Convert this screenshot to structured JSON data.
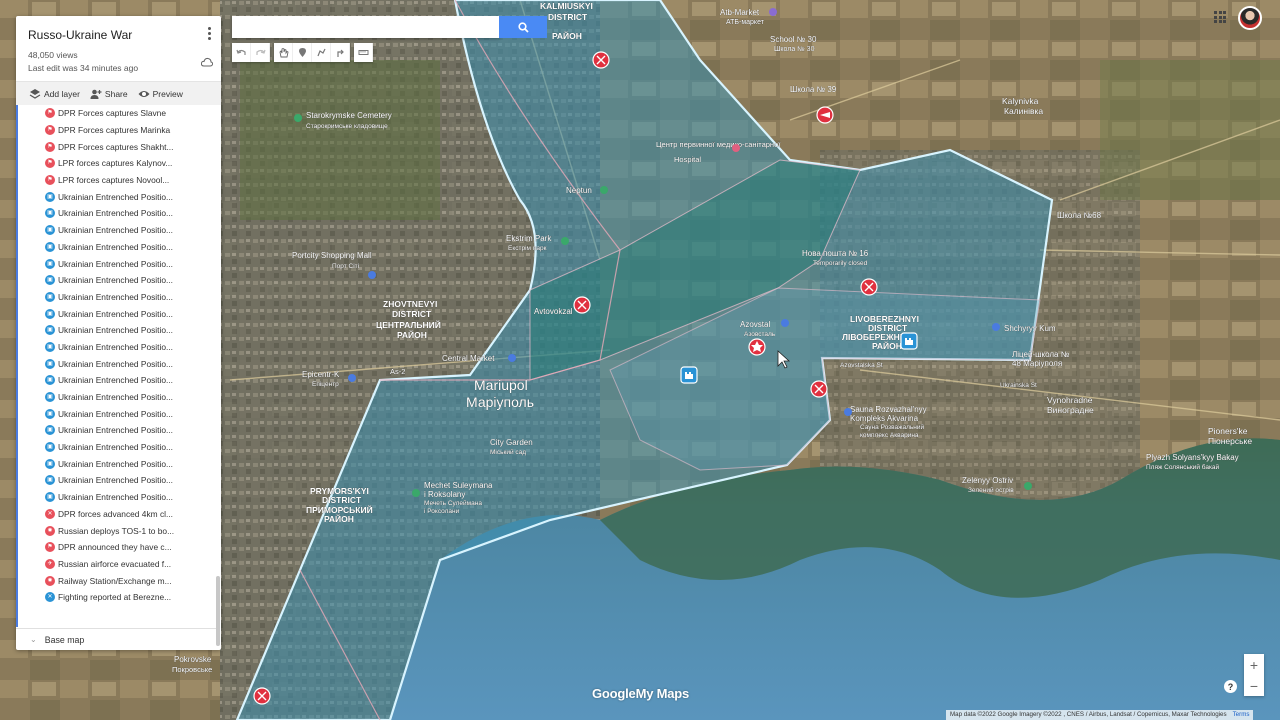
{
  "panel": {
    "title": "Russo-Ukraine War",
    "views": "48,050 views",
    "last_edit": "Last edit was 34 minutes ago",
    "actions": {
      "add_layer": "Add layer",
      "share": "Share",
      "preview": "Preview"
    },
    "base_map": "Base map",
    "items": [
      {
        "label": "DPR Forces captures Slavne",
        "icon": "flag-icon",
        "color": "#e8505b"
      },
      {
        "label": "DPR Forces captures Marinka",
        "icon": "flag-icon",
        "color": "#e8505b"
      },
      {
        "label": "DPR Forces captures Shakht...",
        "icon": "flag-icon",
        "color": "#e8505b"
      },
      {
        "label": "LPR forces captures Kalynov...",
        "icon": "flag-icon",
        "color": "#e8505b"
      },
      {
        "label": "LPR forces captures Novool...",
        "icon": "flag-icon",
        "color": "#e8505b"
      },
      {
        "label": "Ukrainian Entrenched Positio...",
        "icon": "fort-icon",
        "color": "#2a93d5"
      },
      {
        "label": "Ukrainian Entrenched Positio...",
        "icon": "fort-icon",
        "color": "#2a93d5"
      },
      {
        "label": "Ukrainian Entrenched Positio...",
        "icon": "fort-icon",
        "color": "#2a93d5"
      },
      {
        "label": "Ukrainian Entrenched Positio...",
        "icon": "fort-icon",
        "color": "#2a93d5"
      },
      {
        "label": "Ukrainian Entrenched Positio...",
        "icon": "fort-icon",
        "color": "#2a93d5"
      },
      {
        "label": "Ukrainian Entrenched Positio...",
        "icon": "fort-icon",
        "color": "#2a93d5"
      },
      {
        "label": "Ukrainian Entrenched Positio...",
        "icon": "fort-icon",
        "color": "#2a93d5"
      },
      {
        "label": "Ukrainian Entrenched Positio...",
        "icon": "fort-icon",
        "color": "#2a93d5"
      },
      {
        "label": "Ukrainian Entrenched Positio...",
        "icon": "fort-icon",
        "color": "#2a93d5"
      },
      {
        "label": "Ukrainian Entrenched Positio...",
        "icon": "fort-icon",
        "color": "#2a93d5"
      },
      {
        "label": "Ukrainian Entrenched Positio...",
        "icon": "fort-icon",
        "color": "#2a93d5"
      },
      {
        "label": "Ukrainian Entrenched Positio...",
        "icon": "fort-icon",
        "color": "#2a93d5"
      },
      {
        "label": "Ukrainian Entrenched Positio...",
        "icon": "fort-icon",
        "color": "#2a93d5"
      },
      {
        "label": "Ukrainian Entrenched Positio...",
        "icon": "fort-icon",
        "color": "#2a93d5"
      },
      {
        "label": "Ukrainian Entrenched Positio...",
        "icon": "fort-icon",
        "color": "#2a93d5"
      },
      {
        "label": "Ukrainian Entrenched Positio...",
        "icon": "fort-icon",
        "color": "#2a93d5"
      },
      {
        "label": "Ukrainian Entrenched Positio...",
        "icon": "fort-icon",
        "color": "#2a93d5"
      },
      {
        "label": "Ukrainian Entrenched Positio...",
        "icon": "fort-icon",
        "color": "#2a93d5"
      },
      {
        "label": "Ukrainian Entrenched Positio...",
        "icon": "fort-icon",
        "color": "#2a93d5"
      },
      {
        "label": "DPR forces advanced 4km cl...",
        "icon": "crossed-swords-icon",
        "color": "#e8505b"
      },
      {
        "label": "Russian deploys TOS-1 to bo...",
        "icon": "explosion-icon",
        "color": "#e8505b"
      },
      {
        "label": "DPR announced they have c...",
        "icon": "flag-icon",
        "color": "#e8505b"
      },
      {
        "label": "Russian airforce evacuated f...",
        "icon": "plane-icon",
        "color": "#e8505b"
      },
      {
        "label": "Railway Station/Exchange m...",
        "icon": "explosion-icon",
        "color": "#e8505b"
      },
      {
        "label": "Fighting reported at Berezne...",
        "icon": "crossed-swords-icon",
        "color": "#2a93d5"
      }
    ]
  },
  "search": {
    "placeholder": ""
  },
  "map": {
    "labels": {
      "kalmiuskyi_en": "KALMIUSKYI",
      "kalmiuskyi_district": "DISTRICT",
      "kalmiuskyi_ua": "РАЙОН",
      "atb": "Atb-Market",
      "atb_ua": "АТБ-маркет",
      "school30": "School № 30",
      "school30_ua": "Школа № 30",
      "school39": "Школа № 39",
      "kalynivka": "Kalynivka",
      "kalynivka_ua": "Калинівка",
      "starokrymske": "Starokrymske Cemetery",
      "starokrymske_ua": "Старокримське кладовище",
      "hospital": "Центр первинної медико-санітарної",
      "hospital_en": "Hospital",
      "neptun": "Neptun",
      "ekstrim": "Ekstrim Park",
      "ekstrim_ua": "Екстрім парк",
      "portcity": "Portcity Shopping Mall",
      "portcity_ua": "Порт Сіті",
      "zhovtnevyi_en": "ZHOVTNEVYI",
      "zhovtnevyi_district": "DISTRICT",
      "zhovtnevyi_ua1": "ЦЕНТРАЛЬНИЙ",
      "zhovtnevyi_ua2": "РАЙОН",
      "avtovokzal": "Avtovokzal",
      "central_market": "Central Market",
      "as2": "As-2",
      "epicentr": "Epicentr-K",
      "epicentr_ua": "Епіцентр",
      "mariupol_en": "Mariupol",
      "mariupol_ua": "Маріуполь",
      "azovstal": "Azovstal",
      "azovstal_ua": "Азовсталь",
      "nova_poshta": "Нова пошта № 16",
      "temp_closed": "Temporarily closed",
      "livoberezhnyi_en": "LIVOBEREZHNYI",
      "livoberezhnyi_district": "DISTRICT",
      "livoberezhnyi_ua": "ЛІВОБЕРЕЖНИЙ",
      "livoberezhnyi_raion": "РАЙОН",
      "shchyryy": "Shchyryy Kum",
      "school48": "Ліцей-школа №",
      "school48b": "48 Маріуполя",
      "school68": "Школа №68",
      "city_garden": "City Garden",
      "city_garden_ua": "Міський сад",
      "mechet": "Mechet Suleymana",
      "mechet2": "i Roksolany",
      "mechet_ua": "Мечеть Сулеймана",
      "mechet_ua2": "і Роксолани",
      "prymorskyi_en": "PRYMORS'KYI",
      "prymorskyi_district": "DISTRICT",
      "prymorskyi_ua": "ПРИМОРСЬКИЙ",
      "prymorskyi_raion": "РАЙОН",
      "sauna": "Sauna Rozvazhal'nyy",
      "sauna2": "Kompleks Akvarina",
      "sauna_ua": "Сауна Розважальний",
      "sauna_ua2": "комплекс Акварина",
      "vynohradne": "Vynohradne",
      "vynohradne_ua": "Виноградне",
      "pionerske": "Pioners'ke",
      "pionerske_ua": "Піонерське",
      "plyazh": "Plyazh Solyans'kyy Bakay",
      "plyazh_ua": "Пляж Солянський бакай",
      "zelenyy": "Zelenyy Ostriv",
      "zelenyy_ua": "Зелений острів",
      "pokrovske": "Pokrovske",
      "pokrovske_ua": "Покровське",
      "azovstal_st": "Azovstalska St",
      "ukrainska_st": "Ukrainska St"
    }
  },
  "footer": {
    "attribution": "Map data ©2022 Google Imagery ©2022 , CNES / Airbus, Landsat / Copernicus, Maxar Technologies",
    "terms": "Terms",
    "logo_google": "Google",
    "logo_mymaps": "My Maps"
  },
  "colors": {
    "occupied_fill": "#3a8fb0",
    "border": "#d8f4ff",
    "red_marker": "#e0303f",
    "blue_marker": "#2a93d5"
  }
}
